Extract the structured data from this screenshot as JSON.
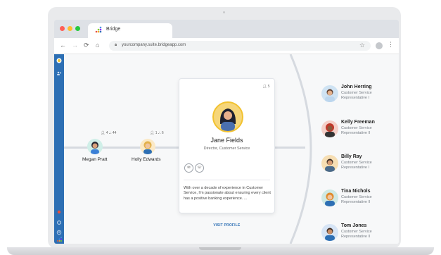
{
  "browser": {
    "tab_title": "Bridge",
    "url": "yourcompany.suite.bridgeapp.com",
    "traffic_lights": [
      "#ff5f56",
      "#ffbd2e",
      "#27c93f"
    ]
  },
  "colors": {
    "sidebar": "#2d6fb4",
    "accent": "#2d6fb4",
    "avatar_ring": "#f2c230"
  },
  "chain": [
    {
      "name": "Megan Pratt",
      "reports": "4",
      "team": "44"
    },
    {
      "name": "Holly Edwards",
      "reports": "1",
      "team": "6"
    }
  ],
  "card": {
    "name": "Jane Fields",
    "title": "Director, Customer Service",
    "reports": "5",
    "bio": "With over a decade of experience in Customer Service, I'm passionate about ensuring every client has a positive banking experience. ...",
    "link": "VISIT PROFILE",
    "action_icons": [
      "email-icon",
      "phone-icon"
    ]
  },
  "reports": [
    {
      "name": "John Herring",
      "role": "Customer Service Representative I"
    },
    {
      "name": "Kelly Freeman",
      "role": "Customer Service Representative II"
    },
    {
      "name": "Billy Ray",
      "role": "Customer Service Representative I"
    },
    {
      "name": "Tina Nichols",
      "role": "Customer Service Representative II"
    },
    {
      "name": "Tom Jones",
      "role": "Customer Service Representative II"
    }
  ]
}
